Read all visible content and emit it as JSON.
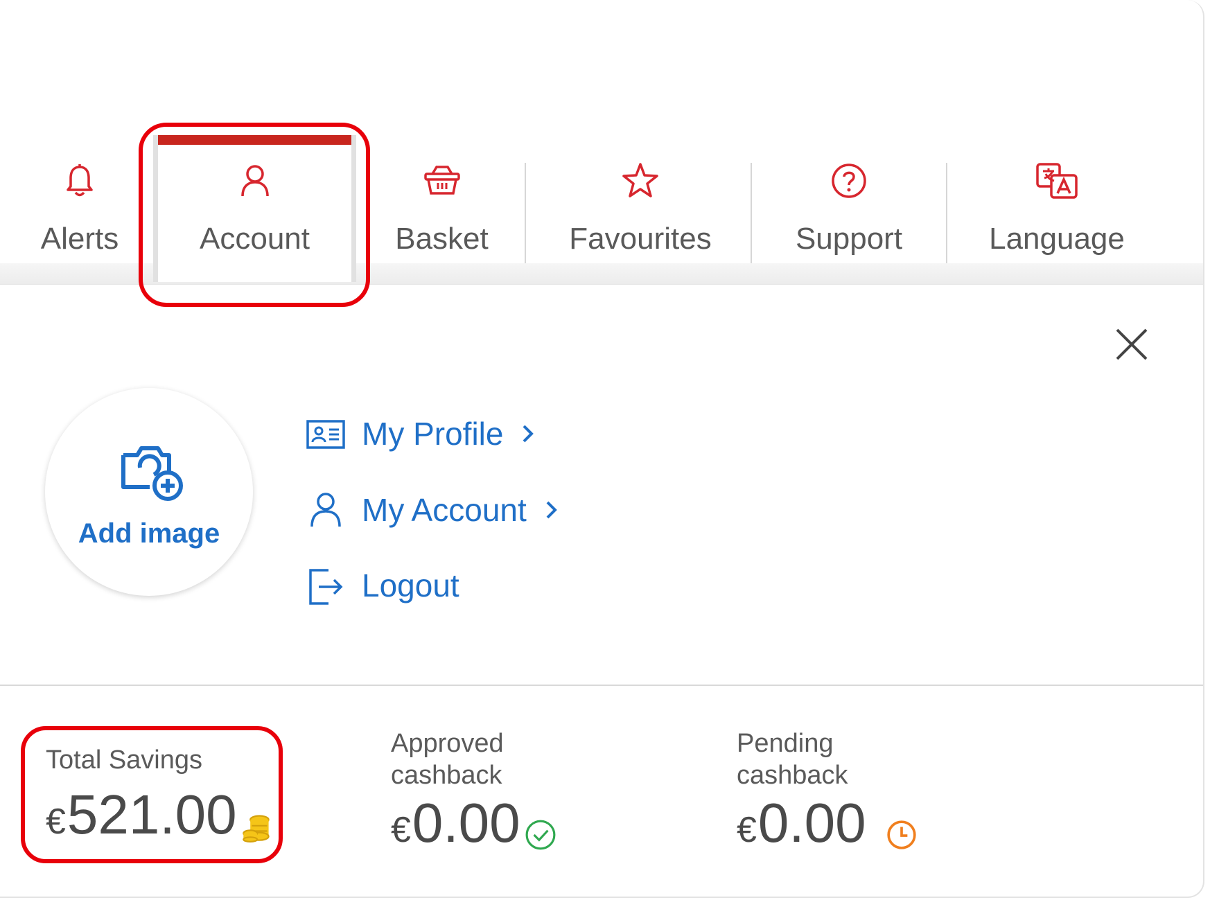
{
  "nav": {
    "tabs": [
      {
        "label": "Alerts",
        "icon": "bell-icon"
      },
      {
        "label": "Account",
        "icon": "user-icon",
        "active": true
      },
      {
        "label": "Basket",
        "icon": "basket-icon"
      },
      {
        "label": "Favourites",
        "icon": "star-icon"
      },
      {
        "label": "Support",
        "icon": "help-circle-icon"
      },
      {
        "label": "Language",
        "icon": "translate-icon"
      }
    ],
    "accent_color": "#c8261e"
  },
  "profile": {
    "add_image_label": "Add image",
    "links": [
      {
        "label": "My Profile",
        "icon": "id-card-icon"
      },
      {
        "label": "My Account",
        "icon": "user-icon"
      },
      {
        "label": "Logout",
        "icon": "logout-icon"
      }
    ],
    "link_color": "#1f6fc7"
  },
  "stats": {
    "total_savings": {
      "title": "Total Savings",
      "currency": "€",
      "amount": "521.00",
      "icon": "coins-icon"
    },
    "approved": {
      "title_line1": "Approved",
      "title_line2": "cashback",
      "currency": "€",
      "amount": "0.00",
      "icon": "check-circle-icon"
    },
    "pending": {
      "title_line1": "Pending",
      "title_line2": "cashback",
      "currency": "€",
      "amount": "0.00",
      "icon": "clock-icon"
    }
  }
}
